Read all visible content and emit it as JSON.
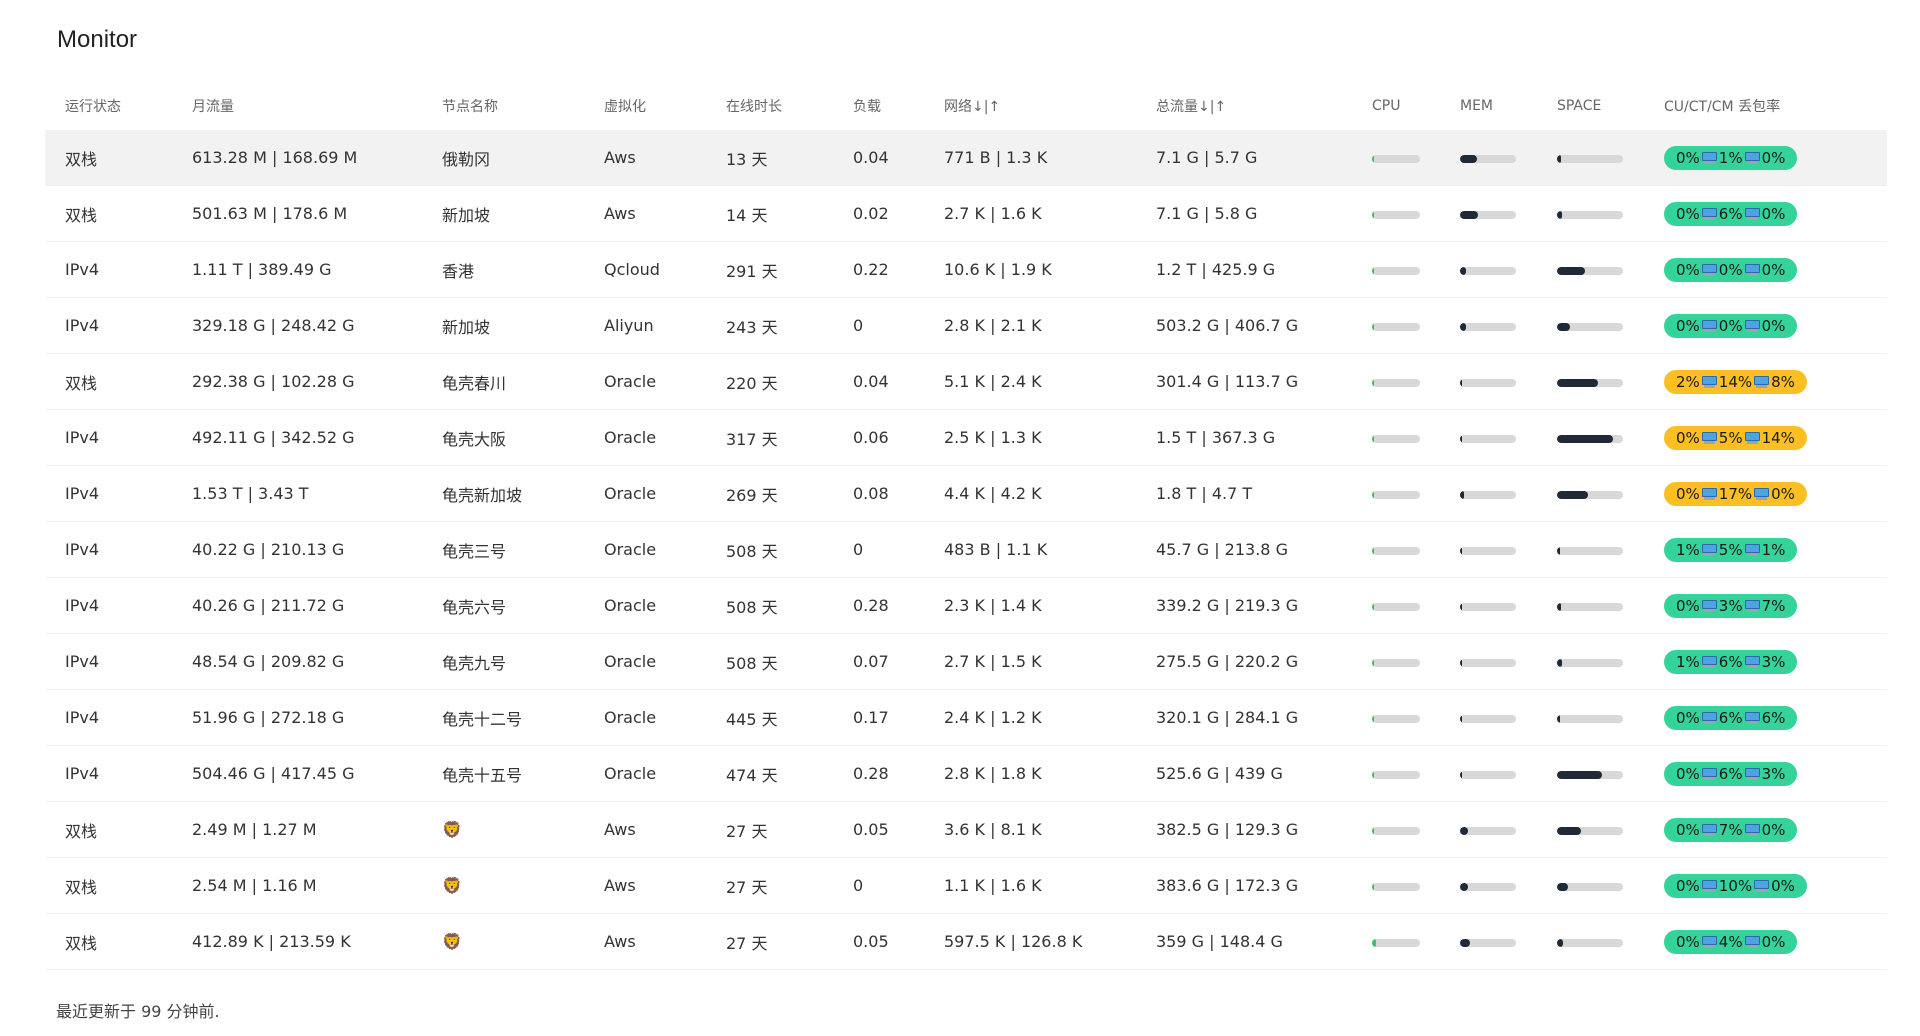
{
  "title": "Monitor",
  "headers": [
    "运行状态",
    "月流量",
    "节点名称",
    "虚拟化",
    "在线时长",
    "负载",
    "网络↓|↑",
    "总流量↓|↑",
    "CPU",
    "MEM",
    "SPACE",
    "CU/CT/CM 丢包率"
  ],
  "rows": [
    {
      "status": "双栈",
      "monthly": "613.28 M | 168.69 M",
      "name": "俄勒冈",
      "virt": "Aws",
      "uptime": "13 天",
      "load": "0.04",
      "net": "771 B | 1.3 K",
      "total": "7.1 G | 5.7 G",
      "cpu": 0.02,
      "mem": 0.3,
      "space": 0.06,
      "loss": [
        "0%",
        "1%",
        "0%"
      ],
      "loss_level": "green"
    },
    {
      "status": "双栈",
      "monthly": "501.63 M | 178.6 M",
      "name": "新加坡",
      "virt": "Aws",
      "uptime": "14 天",
      "load": "0.02",
      "net": "2.7 K | 1.6 K",
      "total": "7.1 G | 5.8 G",
      "cpu": 0.01,
      "mem": 0.33,
      "space": 0.07,
      "loss": [
        "0%",
        "6%",
        "0%"
      ],
      "loss_level": "green"
    },
    {
      "status": "IPv4",
      "monthly": "1.11 T | 389.49 G",
      "name": "香港",
      "virt": "Qcloud",
      "uptime": "291 天",
      "load": "0.22",
      "net": "10.6 K | 1.9 K",
      "total": "1.2 T | 425.9 G",
      "cpu": 0.03,
      "mem": 0.1,
      "space": 0.42,
      "loss": [
        "0%",
        "0%",
        "0%"
      ],
      "loss_level": "green"
    },
    {
      "status": "IPv4",
      "monthly": "329.18 G | 248.42 G",
      "name": "新加坡",
      "virt": "Aliyun",
      "uptime": "243 天",
      "load": "0",
      "net": "2.8 K | 2.1 K",
      "total": "503.2 G | 406.7 G",
      "cpu": 0.01,
      "mem": 0.1,
      "space": 0.2,
      "loss": [
        "0%",
        "0%",
        "0%"
      ],
      "loss_level": "green"
    },
    {
      "status": "双栈",
      "monthly": "292.38 G | 102.28 G",
      "name": "龟壳春川",
      "virt": "Oracle",
      "uptime": "220 天",
      "load": "0.04",
      "net": "5.1 K | 2.4 K",
      "total": "301.4 G | 113.7 G",
      "cpu": 0.02,
      "mem": 0.02,
      "space": 0.62,
      "loss": [
        "2%",
        "14%",
        "8%"
      ],
      "loss_level": "yellow"
    },
    {
      "status": "IPv4",
      "monthly": "492.11 G | 342.52 G",
      "name": "龟壳大阪",
      "virt": "Oracle",
      "uptime": "317 天",
      "load": "0.06",
      "net": "2.5 K | 1.3 K",
      "total": "1.5 T | 367.3 G",
      "cpu": 0.02,
      "mem": 0.02,
      "space": 0.85,
      "loss": [
        "0%",
        "5%",
        "14%"
      ],
      "loss_level": "yellow"
    },
    {
      "status": "IPv4",
      "monthly": "1.53 T | 3.43 T",
      "name": "龟壳新加坡",
      "virt": "Oracle",
      "uptime": "269 天",
      "load": "0.08",
      "net": "4.4 K | 4.2 K",
      "total": "1.8 T | 4.7 T",
      "cpu": 0.02,
      "mem": 0.08,
      "space": 0.47,
      "loss": [
        "0%",
        "17%",
        "0%"
      ],
      "loss_level": "yellow"
    },
    {
      "status": "IPv4",
      "monthly": "40.22 G | 210.13 G",
      "name": "龟壳三号",
      "virt": "Oracle",
      "uptime": "508 天",
      "load": "0",
      "net": "483 B | 1.1 K",
      "total": "45.7 G | 213.8 G",
      "cpu": 0.01,
      "mem": 0.02,
      "space": 0.04,
      "loss": [
        "1%",
        "5%",
        "1%"
      ],
      "loss_level": "green"
    },
    {
      "status": "IPv4",
      "monthly": "40.26 G | 211.72 G",
      "name": "龟壳六号",
      "virt": "Oracle",
      "uptime": "508 天",
      "load": "0.28",
      "net": "2.3 K | 1.4 K",
      "total": "339.2 G | 219.3 G",
      "cpu": 0.01,
      "mem": 0.02,
      "space": 0.06,
      "loss": [
        "0%",
        "3%",
        "7%"
      ],
      "loss_level": "green"
    },
    {
      "status": "IPv4",
      "monthly": "48.54 G | 209.82 G",
      "name": "龟壳九号",
      "virt": "Oracle",
      "uptime": "508 天",
      "load": "0.07",
      "net": "2.7 K | 1.5 K",
      "total": "275.5 G | 220.2 G",
      "cpu": 0.01,
      "mem": 0.02,
      "space": 0.07,
      "loss": [
        "1%",
        "6%",
        "3%"
      ],
      "loss_level": "green"
    },
    {
      "status": "IPv4",
      "monthly": "51.96 G | 272.18 G",
      "name": "龟壳十二号",
      "virt": "Oracle",
      "uptime": "445 天",
      "load": "0.17",
      "net": "2.4 K | 1.2 K",
      "total": "320.1 G | 284.1 G",
      "cpu": 0.01,
      "mem": 0.02,
      "space": 0.05,
      "loss": [
        "0%",
        "6%",
        "6%"
      ],
      "loss_level": "green"
    },
    {
      "status": "IPv4",
      "monthly": "504.46 G | 417.45 G",
      "name": "龟壳十五号",
      "virt": "Oracle",
      "uptime": "474 天",
      "load": "0.28",
      "net": "2.8 K | 1.8 K",
      "total": "525.6 G | 439 G",
      "cpu": 0.01,
      "mem": 0.02,
      "space": 0.68,
      "loss": [
        "0%",
        "6%",
        "3%"
      ],
      "loss_level": "green"
    },
    {
      "status": "双栈",
      "monthly": "2.49 M | 1.27 M",
      "name": "",
      "name_icon": "lion-emoji",
      "virt": "Aws",
      "uptime": "27 天",
      "load": "0.05",
      "net": "3.6 K | 8.1 K",
      "total": "382.5 G | 129.3 G",
      "cpu": 0.01,
      "mem": 0.14,
      "space": 0.36,
      "loss": [
        "0%",
        "7%",
        "0%"
      ],
      "loss_level": "green"
    },
    {
      "status": "双栈",
      "monthly": "2.54 M | 1.16 M",
      "name": "",
      "name_icon": "lion-emoji",
      "virt": "Aws",
      "uptime": "27 天",
      "load": "0",
      "net": "1.1 K | 1.6 K",
      "total": "383.6 G | 172.3 G",
      "cpu": 0.01,
      "mem": 0.14,
      "space": 0.16,
      "loss": [
        "0%",
        "10%",
        "0%"
      ],
      "loss_level": "green"
    },
    {
      "status": "双栈",
      "monthly": "412.89 K | 213.59 K",
      "name": "",
      "name_icon": "lion-emoji",
      "virt": "Aws",
      "uptime": "27 天",
      "load": "0.05",
      "net": "597.5 K | 126.8 K",
      "total": "359 G | 148.4 G",
      "cpu": 0.08,
      "mem": 0.18,
      "space": 0.09,
      "loss": [
        "0%",
        "4%",
        "0%"
      ],
      "loss_level": "green"
    }
  ],
  "footer": "最近更新于 99 分钟前."
}
